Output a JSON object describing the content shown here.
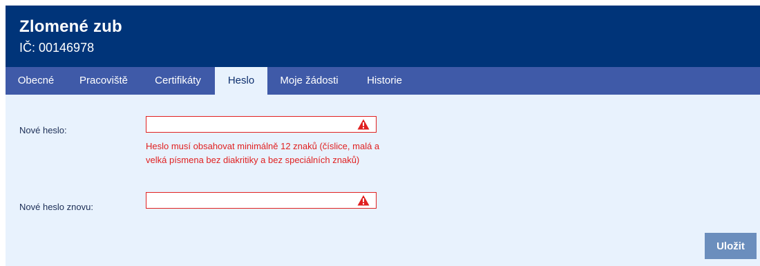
{
  "header": {
    "title": "Zlomené zub",
    "subtitle": "IČ: 00146978"
  },
  "tabs": [
    {
      "label": "Obecné",
      "active": false
    },
    {
      "label": "Pracoviště",
      "active": false
    },
    {
      "label": "Certifikáty",
      "active": false
    },
    {
      "label": "Heslo",
      "active": true
    },
    {
      "label": "Moje žádosti",
      "active": false
    },
    {
      "label": "Historie",
      "active": false
    }
  ],
  "form": {
    "new_password_label": "Nové heslo:",
    "new_password_value": "",
    "new_password_error": "Heslo musí obsahovat minimálně 12 znaků (číslice, malá a velká písmena bez diakritiky a bez speciálních znaků)",
    "confirm_password_label": "Nové heslo znovu:",
    "confirm_password_value": "",
    "warning_icon": "warning-triangle-icon"
  },
  "actions": {
    "save_label": "Uložit"
  },
  "colors": {
    "header_bg": "#003479",
    "tabs_bg": "#3f5aa8",
    "content_bg": "#e8f2fd",
    "error": "#e02020",
    "save_button": "#6b8ebd"
  }
}
